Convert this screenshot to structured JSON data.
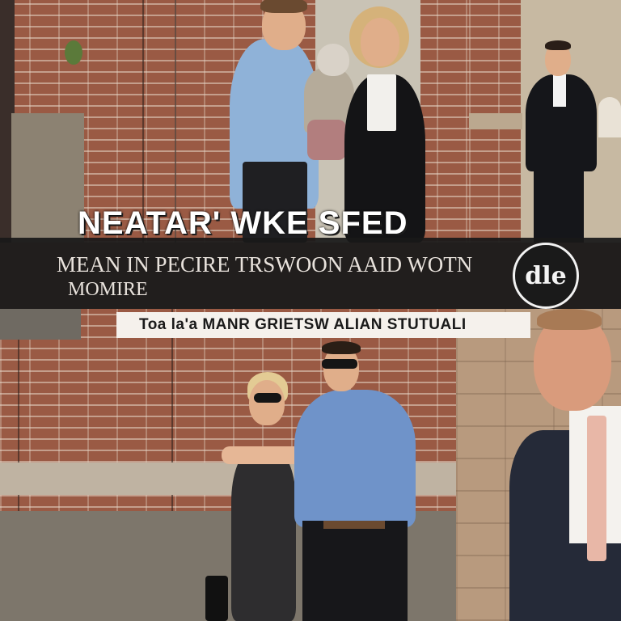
{
  "headline": "NEATAR' WKE SFED",
  "subtitle_line1": "MEAN IN PECIRE TRSWOON AAID WOTN",
  "subtitle_line2": "MOMIRE",
  "caption": "Toa la'a MANR GRIETSW ALIAN STUTUALI",
  "logo_text": "dle",
  "colors": {
    "band": "#191919",
    "headline": "#ffffff",
    "caption_bar": "#f5f1ec"
  }
}
